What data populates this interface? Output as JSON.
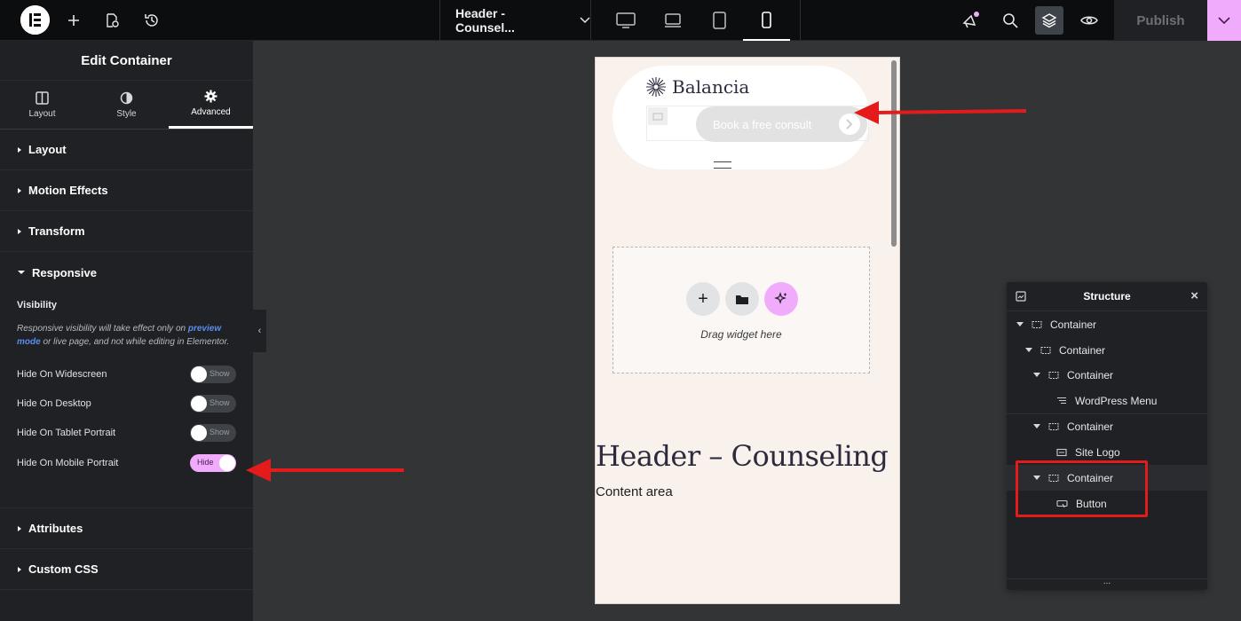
{
  "topbar": {
    "logo_icon": "elementor-logo",
    "add_icon": "plus-icon",
    "page_settings_icon": "page-settings-icon",
    "history_icon": "history-icon",
    "document_title": "Header - Counsel...",
    "devices": [
      "desktop",
      "laptop",
      "tablet",
      "mobile"
    ],
    "active_device": "mobile",
    "publish_label": "Publish",
    "accent": "#f0abfc"
  },
  "panel": {
    "title": "Edit Container",
    "tabs": [
      {
        "label": "Layout",
        "icon": "layout-icon"
      },
      {
        "label": "Style",
        "icon": "style-icon"
      },
      {
        "label": "Advanced",
        "icon": "gear-icon"
      }
    ],
    "active_tab": "Advanced",
    "sections": {
      "layout": "Layout",
      "motion": "Motion Effects",
      "transform": "Transform",
      "responsive": "Responsive",
      "attributes": "Attributes",
      "custom_css": "Custom CSS"
    },
    "visibility": {
      "label": "Visibility",
      "note_before": "Responsive visibility will take effect only on ",
      "note_link": "preview mode",
      "note_after": " or live page, and not while editing in Elementor.",
      "rows": [
        {
          "label": "Hide On Widescreen",
          "state": "Show"
        },
        {
          "label": "Hide On Desktop",
          "state": "Show"
        },
        {
          "label": "Hide On Tablet Portrait",
          "state": "Show"
        },
        {
          "label": "Hide On Mobile Portrait",
          "state": "Hide"
        }
      ]
    }
  },
  "canvas": {
    "brand_name": "Balancia",
    "button_text": "Book a free consult",
    "dropzone_text": "Drag widget here",
    "heading": "Header – Counseling",
    "content": "Content area",
    "bg_color": "#f8f1ec"
  },
  "structure": {
    "title": "Structure",
    "nodes": [
      {
        "label": "Container",
        "type": "container"
      },
      {
        "label": "Container",
        "type": "container"
      },
      {
        "label": "Container",
        "type": "container"
      },
      {
        "label": "WordPress Menu",
        "type": "widget"
      },
      {
        "label": "Container",
        "type": "container"
      },
      {
        "label": "Site Logo",
        "type": "widget"
      },
      {
        "label": "Container",
        "type": "container"
      },
      {
        "label": "Button",
        "type": "widget"
      }
    ],
    "footer": "..."
  },
  "annotations": {
    "highlight_color": "#e41b1b"
  }
}
